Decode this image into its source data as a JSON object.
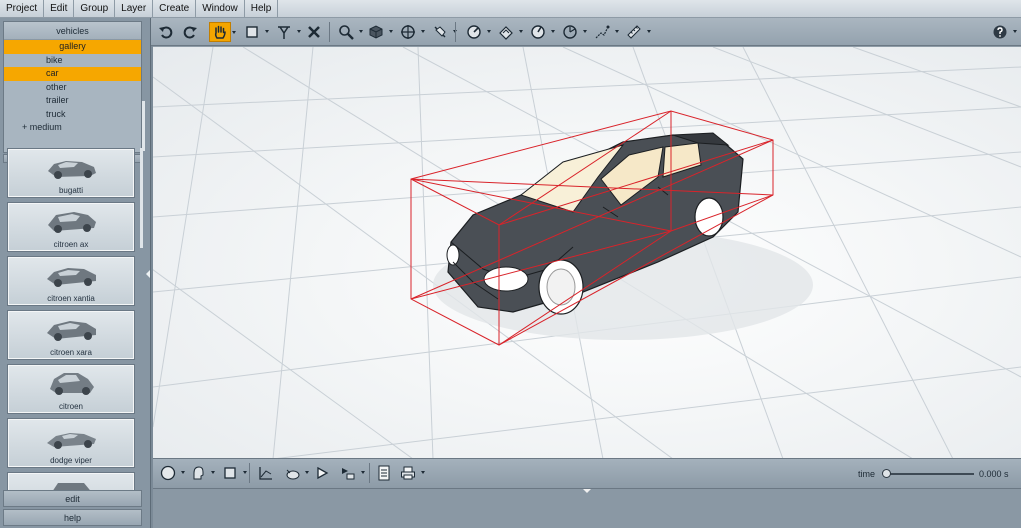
{
  "menu": [
    "Project",
    "Edit",
    "Group",
    "Layer",
    "Create",
    "Window",
    "Help"
  ],
  "library": {
    "root": "vehicles",
    "tree": [
      {
        "label": "gallery",
        "level": "l1",
        "selected": true
      },
      {
        "label": "bike",
        "level": "l2",
        "selected": false
      },
      {
        "label": "car",
        "level": "l2",
        "selected": true
      },
      {
        "label": "other",
        "level": "l2",
        "selected": false
      },
      {
        "label": "trailer",
        "level": "l2",
        "selected": false
      },
      {
        "label": "truck",
        "level": "l2",
        "selected": false
      },
      {
        "label": "+  medium",
        "level": "l1b",
        "selected": false
      }
    ],
    "thumbnails": [
      "bugatti",
      "citroen ax",
      "citroen xantia",
      "citroen xara",
      "citroen",
      "dodge viper",
      ""
    ],
    "buttons": {
      "edit": "edit",
      "help": "help"
    }
  },
  "toolbar": {
    "icons": [
      "undo-icon",
      "redo-icon",
      "pan-hand-icon",
      "select-rect-icon",
      "move-icon",
      "delete-icon",
      "zoom-icon",
      "cube-view-icon",
      "orbit-icon",
      "light-icon",
      "gauge-icon",
      "material-icon",
      "measure-icon",
      "angle-icon",
      "path-icon",
      "ruler-icon",
      "help-icon"
    ],
    "active": "pan-hand-icon"
  },
  "timeline": {
    "label": "time",
    "value": "0.000 s",
    "position": 0.0
  },
  "colors": {
    "accent": "#f4a500",
    "bbox": "#d9232a",
    "panel": "#8796a3"
  }
}
